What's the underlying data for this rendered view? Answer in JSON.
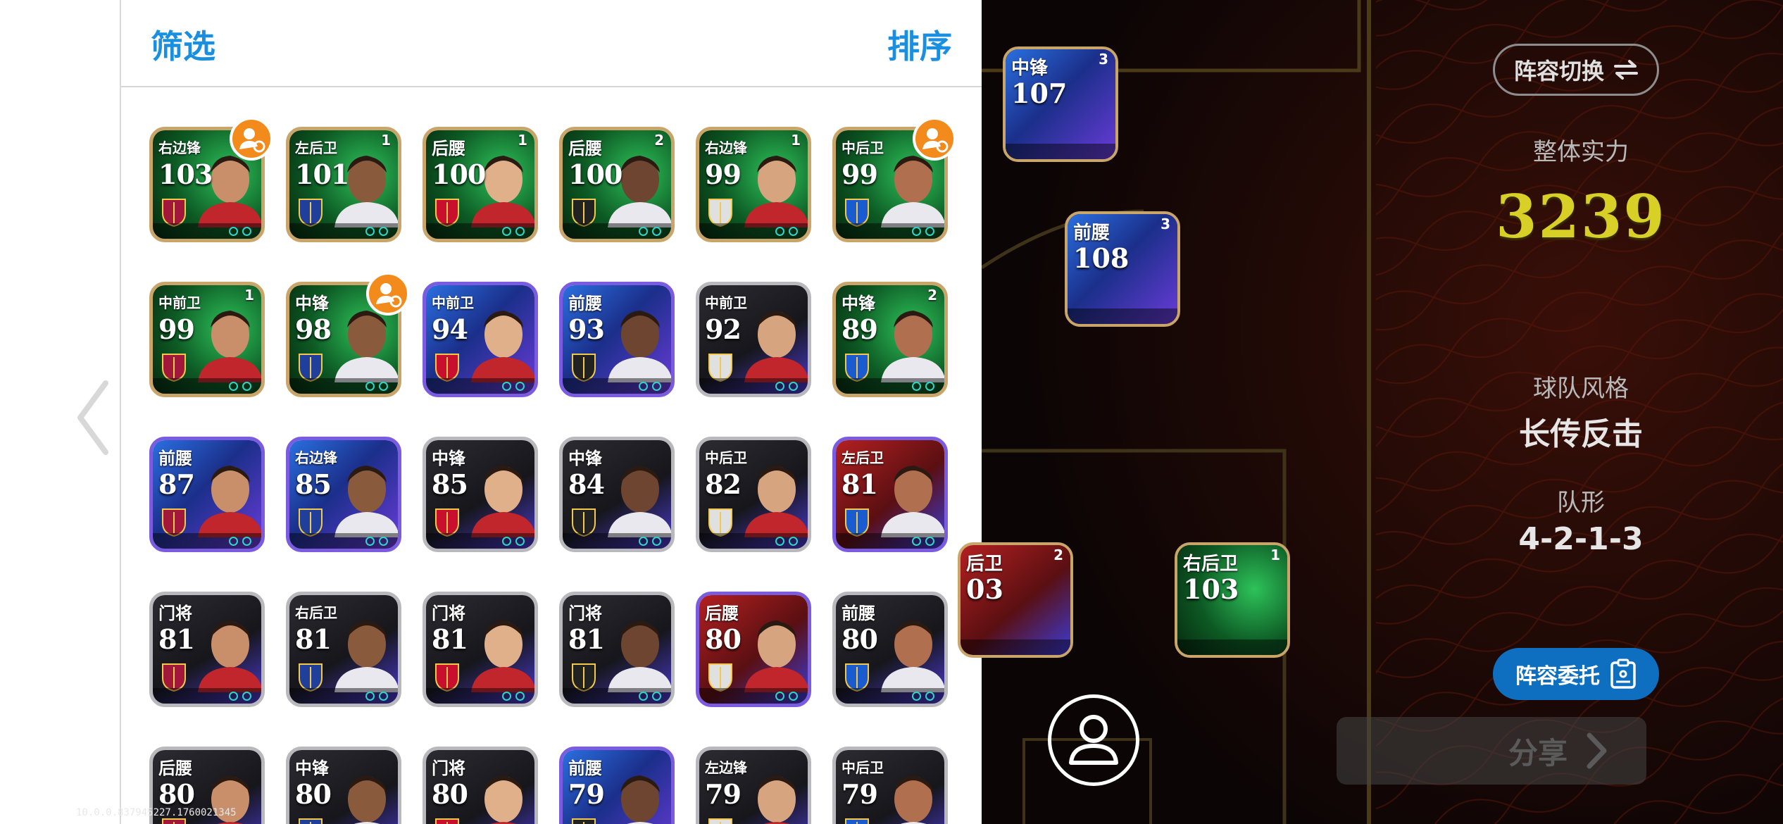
{
  "panel": {
    "filter_label": "筛选",
    "sort_label": "排序"
  },
  "players": [
    {
      "pos": "右边锋",
      "ovr": "103",
      "lvl": "",
      "style": "green",
      "manager_badge": true
    },
    {
      "pos": "左后卫",
      "ovr": "101",
      "lvl": "1",
      "style": "green",
      "manager_badge": false
    },
    {
      "pos": "后腰",
      "ovr": "100",
      "lvl": "1",
      "style": "green",
      "manager_badge": false
    },
    {
      "pos": "后腰",
      "ovr": "100",
      "lvl": "2",
      "style": "green",
      "manager_badge": false
    },
    {
      "pos": "右边锋",
      "ovr": "99",
      "lvl": "1",
      "style": "green",
      "manager_badge": false
    },
    {
      "pos": "中后卫",
      "ovr": "99",
      "lvl": "",
      "style": "green",
      "manager_badge": true
    },
    {
      "pos": "中前卫",
      "ovr": "99",
      "lvl": "1",
      "style": "green",
      "manager_badge": false
    },
    {
      "pos": "中锋",
      "ovr": "98",
      "lvl": "",
      "style": "green",
      "manager_badge": true
    },
    {
      "pos": "中前卫",
      "ovr": "94",
      "lvl": "",
      "style": "blue",
      "manager_badge": false
    },
    {
      "pos": "前腰",
      "ovr": "93",
      "lvl": "",
      "style": "blue",
      "manager_badge": false
    },
    {
      "pos": "中前卫",
      "ovr": "92",
      "lvl": "",
      "style": "dark",
      "manager_badge": false
    },
    {
      "pos": "中锋",
      "ovr": "89",
      "lvl": "2",
      "style": "green",
      "manager_badge": false
    },
    {
      "pos": "前腰",
      "ovr": "87",
      "lvl": "",
      "style": "blue",
      "manager_badge": false
    },
    {
      "pos": "右边锋",
      "ovr": "85",
      "lvl": "",
      "style": "blue",
      "manager_badge": false
    },
    {
      "pos": "中锋",
      "ovr": "85",
      "lvl": "",
      "style": "dark",
      "manager_badge": false
    },
    {
      "pos": "中锋",
      "ovr": "84",
      "lvl": "",
      "style": "dark",
      "manager_badge": false
    },
    {
      "pos": "中后卫",
      "ovr": "82",
      "lvl": "",
      "style": "dark",
      "manager_badge": false
    },
    {
      "pos": "左后卫",
      "ovr": "81",
      "lvl": "",
      "style": "red",
      "manager_badge": false
    },
    {
      "pos": "门将",
      "ovr": "81",
      "lvl": "",
      "style": "dark",
      "manager_badge": false
    },
    {
      "pos": "右后卫",
      "ovr": "81",
      "lvl": "",
      "style": "dark",
      "manager_badge": false
    },
    {
      "pos": "门将",
      "ovr": "81",
      "lvl": "",
      "style": "dark",
      "manager_badge": false
    },
    {
      "pos": "门将",
      "ovr": "81",
      "lvl": "",
      "style": "dark",
      "manager_badge": false
    },
    {
      "pos": "后腰",
      "ovr": "80",
      "lvl": "",
      "style": "red",
      "manager_badge": false
    },
    {
      "pos": "前腰",
      "ovr": "80",
      "lvl": "",
      "style": "dark",
      "manager_badge": false
    },
    {
      "pos": "后腰",
      "ovr": "80",
      "lvl": "",
      "style": "dark",
      "manager_badge": false
    },
    {
      "pos": "中锋",
      "ovr": "80",
      "lvl": "",
      "style": "dark",
      "manager_badge": false
    },
    {
      "pos": "门将",
      "ovr": "80",
      "lvl": "",
      "style": "dark",
      "manager_badge": false
    },
    {
      "pos": "前腰",
      "ovr": "79",
      "lvl": "",
      "style": "blue",
      "manager_badge": false
    },
    {
      "pos": "左边锋",
      "ovr": "79",
      "lvl": "",
      "style": "dark",
      "manager_badge": false
    },
    {
      "pos": "中后卫",
      "ovr": "79",
      "lvl": "",
      "style": "dark",
      "manager_badge": false
    }
  ],
  "pitch_players": [
    {
      "pos": "中锋",
      "ovr": "107",
      "lvl": "3"
    },
    {
      "pos": "前腰",
      "ovr": "108",
      "lvl": "3"
    },
    {
      "pos": "后卫",
      "ovr": "03",
      "lvl": "2"
    },
    {
      "pos": "右后卫",
      "ovr": "103",
      "lvl": "1"
    }
  ],
  "squad": {
    "switch_label": "阵容切换",
    "overall_label": "整体实力",
    "overall_value": "3239",
    "style_label": "球队风格",
    "style_value": "长传反击",
    "formation_label": "队形",
    "formation_value": "4-2-1-3",
    "delegate_label": "阵容委托",
    "share_label": "分享"
  },
  "watermark": "10.0.0.837945227.1760021345",
  "colors": {
    "accent_blue": "#1a8fe0",
    "power_yellow": "#d8d026",
    "delegate_blue": "#0e6fc0",
    "manager_badge_orange": "#f28a1c"
  }
}
